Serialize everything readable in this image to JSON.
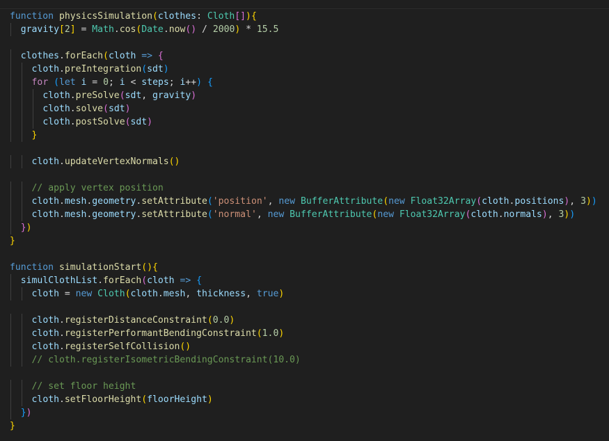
{
  "editor": {
    "theme": {
      "background": "#1f1f1f",
      "keyword": "#569cd6",
      "control": "#c586c0",
      "function": "#dcdcaa",
      "variable": "#9cdcfe",
      "type": "#4ec9b0",
      "number": "#b5cea8",
      "string": "#ce9178",
      "comment": "#6a9955",
      "punctuation": "#d4d4d4",
      "bracket1": "#ffd700",
      "bracket2": "#da70d6",
      "bracket3": "#179fff",
      "indent_guide": "#404040"
    },
    "lines": [
      {
        "indent": 0,
        "tokens": [
          [
            "function",
            "keyword"
          ],
          [
            " ",
            "punctuation"
          ],
          [
            "physicsSimulation",
            "function"
          ],
          [
            "(",
            "bracket1"
          ],
          [
            "clothes",
            "variable"
          ],
          [
            ": ",
            "punctuation"
          ],
          [
            "Cloth",
            "type"
          ],
          [
            "[]",
            "bracket2"
          ],
          [
            ")",
            "bracket1"
          ],
          [
            "{",
            "bracket1"
          ]
        ]
      },
      {
        "indent": 1,
        "tokens": [
          [
            "gravity",
            "variable"
          ],
          [
            "[",
            "bracket1"
          ],
          [
            "2",
            "number"
          ],
          [
            "]",
            "bracket1"
          ],
          [
            " = ",
            "punctuation"
          ],
          [
            "Math",
            "type"
          ],
          [
            ".",
            "punctuation"
          ],
          [
            "cos",
            "function"
          ],
          [
            "(",
            "bracket1"
          ],
          [
            "Date",
            "type"
          ],
          [
            ".",
            "punctuation"
          ],
          [
            "now",
            "function"
          ],
          [
            "()",
            "bracket2"
          ],
          [
            " / ",
            "punctuation"
          ],
          [
            "2000",
            "number"
          ],
          [
            ")",
            "bracket1"
          ],
          [
            " * ",
            "punctuation"
          ],
          [
            "15.5",
            "number"
          ]
        ]
      },
      {
        "indent": 0,
        "tokens": []
      },
      {
        "indent": 1,
        "tokens": [
          [
            "clothes",
            "variable"
          ],
          [
            ".",
            "punctuation"
          ],
          [
            "forEach",
            "function"
          ],
          [
            "(",
            "bracket1"
          ],
          [
            "cloth",
            "variable"
          ],
          [
            " ",
            "punctuation"
          ],
          [
            "=>",
            "keyword"
          ],
          [
            " ",
            "punctuation"
          ],
          [
            "{",
            "bracket2"
          ]
        ]
      },
      {
        "indent": 2,
        "tokens": [
          [
            "cloth",
            "variable"
          ],
          [
            ".",
            "punctuation"
          ],
          [
            "preIntegration",
            "function"
          ],
          [
            "(",
            "bracket3"
          ],
          [
            "sdt",
            "variable"
          ],
          [
            ")",
            "bracket3"
          ]
        ]
      },
      {
        "indent": 2,
        "tokens": [
          [
            "for",
            "control"
          ],
          [
            " ",
            "punctuation"
          ],
          [
            "(",
            "bracket3"
          ],
          [
            "let",
            "keyword"
          ],
          [
            " ",
            "punctuation"
          ],
          [
            "i",
            "variable"
          ],
          [
            " = ",
            "punctuation"
          ],
          [
            "0",
            "number"
          ],
          [
            "; ",
            "punctuation"
          ],
          [
            "i",
            "variable"
          ],
          [
            " < ",
            "punctuation"
          ],
          [
            "steps",
            "variable"
          ],
          [
            "; ",
            "punctuation"
          ],
          [
            "i",
            "variable"
          ],
          [
            "++",
            "punctuation"
          ],
          [
            ")",
            "bracket3"
          ],
          [
            " ",
            "punctuation"
          ],
          [
            "{",
            "bracket3"
          ]
        ]
      },
      {
        "indent": 3,
        "tokens": [
          [
            "cloth",
            "variable"
          ],
          [
            ".",
            "punctuation"
          ],
          [
            "preSolve",
            "function"
          ],
          [
            "(",
            "bracket2"
          ],
          [
            "sdt",
            "variable"
          ],
          [
            ", ",
            "punctuation"
          ],
          [
            "gravity",
            "variable"
          ],
          [
            ")",
            "bracket2"
          ]
        ]
      },
      {
        "indent": 3,
        "tokens": [
          [
            "cloth",
            "variable"
          ],
          [
            ".",
            "punctuation"
          ],
          [
            "solve",
            "function"
          ],
          [
            "(",
            "bracket2"
          ],
          [
            "sdt",
            "variable"
          ],
          [
            ")",
            "bracket2"
          ]
        ]
      },
      {
        "indent": 3,
        "tokens": [
          [
            "cloth",
            "variable"
          ],
          [
            ".",
            "punctuation"
          ],
          [
            "postSolve",
            "function"
          ],
          [
            "(",
            "bracket2"
          ],
          [
            "sdt",
            "variable"
          ],
          [
            ")",
            "bracket2"
          ]
        ]
      },
      {
        "indent": 2,
        "tokens": [
          [
            "}",
            "bracket1"
          ]
        ]
      },
      {
        "indent": 0,
        "tokens": []
      },
      {
        "indent": 2,
        "tokens": [
          [
            "cloth",
            "variable"
          ],
          [
            ".",
            "punctuation"
          ],
          [
            "updateVertexNormals",
            "function"
          ],
          [
            "()",
            "bracket1"
          ]
        ]
      },
      {
        "indent": 0,
        "tokens": []
      },
      {
        "indent": 2,
        "tokens": [
          [
            "// apply vertex position",
            "comment"
          ]
        ]
      },
      {
        "indent": 2,
        "tokens": [
          [
            "cloth",
            "variable"
          ],
          [
            ".",
            "punctuation"
          ],
          [
            "mesh",
            "variable"
          ],
          [
            ".",
            "punctuation"
          ],
          [
            "geometry",
            "variable"
          ],
          [
            ".",
            "punctuation"
          ],
          [
            "setAttribute",
            "function"
          ],
          [
            "(",
            "bracket3"
          ],
          [
            "'position'",
            "string"
          ],
          [
            ", ",
            "punctuation"
          ],
          [
            "new",
            "keyword"
          ],
          [
            " ",
            "punctuation"
          ],
          [
            "BufferAttribute",
            "type"
          ],
          [
            "(",
            "bracket1"
          ],
          [
            "new",
            "keyword"
          ],
          [
            " ",
            "punctuation"
          ],
          [
            "Float32Array",
            "type"
          ],
          [
            "(",
            "bracket2"
          ],
          [
            "cloth",
            "variable"
          ],
          [
            ".",
            "punctuation"
          ],
          [
            "positions",
            "variable"
          ],
          [
            ")",
            "bracket2"
          ],
          [
            ", ",
            "punctuation"
          ],
          [
            "3",
            "number"
          ],
          [
            ")",
            "bracket1"
          ],
          [
            ")",
            "bracket3"
          ]
        ]
      },
      {
        "indent": 2,
        "tokens": [
          [
            "cloth",
            "variable"
          ],
          [
            ".",
            "punctuation"
          ],
          [
            "mesh",
            "variable"
          ],
          [
            ".",
            "punctuation"
          ],
          [
            "geometry",
            "variable"
          ],
          [
            ".",
            "punctuation"
          ],
          [
            "setAttribute",
            "function"
          ],
          [
            "(",
            "bracket3"
          ],
          [
            "'normal'",
            "string"
          ],
          [
            ", ",
            "punctuation"
          ],
          [
            "new",
            "keyword"
          ],
          [
            " ",
            "punctuation"
          ],
          [
            "BufferAttribute",
            "type"
          ],
          [
            "(",
            "bracket1"
          ],
          [
            "new",
            "keyword"
          ],
          [
            " ",
            "punctuation"
          ],
          [
            "Float32Array",
            "type"
          ],
          [
            "(",
            "bracket2"
          ],
          [
            "cloth",
            "variable"
          ],
          [
            ".",
            "punctuation"
          ],
          [
            "normals",
            "variable"
          ],
          [
            ")",
            "bracket2"
          ],
          [
            ", ",
            "punctuation"
          ],
          [
            "3",
            "number"
          ],
          [
            ")",
            "bracket1"
          ],
          [
            ")",
            "bracket3"
          ]
        ]
      },
      {
        "indent": 1,
        "tokens": [
          [
            "}",
            "bracket2"
          ],
          [
            ")",
            "bracket1"
          ]
        ]
      },
      {
        "indent": 0,
        "tokens": [
          [
            "}",
            "bracket1"
          ]
        ]
      },
      {
        "indent": 0,
        "tokens": []
      },
      {
        "indent": 0,
        "tokens": [
          [
            "function",
            "keyword"
          ],
          [
            " ",
            "punctuation"
          ],
          [
            "simulationStart",
            "function"
          ],
          [
            "()",
            "bracket1"
          ],
          [
            "{",
            "bracket1"
          ]
        ]
      },
      {
        "indent": 1,
        "tokens": [
          [
            "simulClothList",
            "variable"
          ],
          [
            ".",
            "punctuation"
          ],
          [
            "forEach",
            "function"
          ],
          [
            "(",
            "bracket2"
          ],
          [
            "cloth",
            "variable"
          ],
          [
            " ",
            "punctuation"
          ],
          [
            "=>",
            "keyword"
          ],
          [
            " ",
            "punctuation"
          ],
          [
            "{",
            "bracket3"
          ]
        ]
      },
      {
        "indent": 2,
        "tokens": [
          [
            "cloth",
            "variable"
          ],
          [
            " = ",
            "punctuation"
          ],
          [
            "new",
            "keyword"
          ],
          [
            " ",
            "punctuation"
          ],
          [
            "Cloth",
            "type"
          ],
          [
            "(",
            "bracket1"
          ],
          [
            "cloth",
            "variable"
          ],
          [
            ".",
            "punctuation"
          ],
          [
            "mesh",
            "variable"
          ],
          [
            ", ",
            "punctuation"
          ],
          [
            "thickness",
            "variable"
          ],
          [
            ", ",
            "punctuation"
          ],
          [
            "true",
            "keyword"
          ],
          [
            ")",
            "bracket1"
          ]
        ]
      },
      {
        "indent": 0,
        "tokens": []
      },
      {
        "indent": 2,
        "tokens": [
          [
            "cloth",
            "variable"
          ],
          [
            ".",
            "punctuation"
          ],
          [
            "registerDistanceConstraint",
            "function"
          ],
          [
            "(",
            "bracket1"
          ],
          [
            "0.0",
            "number"
          ],
          [
            ")",
            "bracket1"
          ]
        ]
      },
      {
        "indent": 2,
        "tokens": [
          [
            "cloth",
            "variable"
          ],
          [
            ".",
            "punctuation"
          ],
          [
            "registerPerformantBendingConstraint",
            "function"
          ],
          [
            "(",
            "bracket1"
          ],
          [
            "1.0",
            "number"
          ],
          [
            ")",
            "bracket1"
          ]
        ]
      },
      {
        "indent": 2,
        "tokens": [
          [
            "cloth",
            "variable"
          ],
          [
            ".",
            "punctuation"
          ],
          [
            "registerSelfCollision",
            "function"
          ],
          [
            "()",
            "bracket1"
          ]
        ]
      },
      {
        "indent": 2,
        "tokens": [
          [
            "// cloth.registerIsometricBendingConstraint(10.0)",
            "comment"
          ]
        ]
      },
      {
        "indent": 0,
        "tokens": []
      },
      {
        "indent": 2,
        "tokens": [
          [
            "// set floor height",
            "comment"
          ]
        ]
      },
      {
        "indent": 2,
        "tokens": [
          [
            "cloth",
            "variable"
          ],
          [
            ".",
            "punctuation"
          ],
          [
            "setFloorHeight",
            "function"
          ],
          [
            "(",
            "bracket1"
          ],
          [
            "floorHeight",
            "variable"
          ],
          [
            ")",
            "bracket1"
          ]
        ]
      },
      {
        "indent": 1,
        "tokens": [
          [
            "}",
            "bracket3"
          ],
          [
            ")",
            "bracket2"
          ]
        ]
      },
      {
        "indent": 0,
        "tokens": [
          [
            "}",
            "bracket1"
          ]
        ]
      }
    ]
  }
}
